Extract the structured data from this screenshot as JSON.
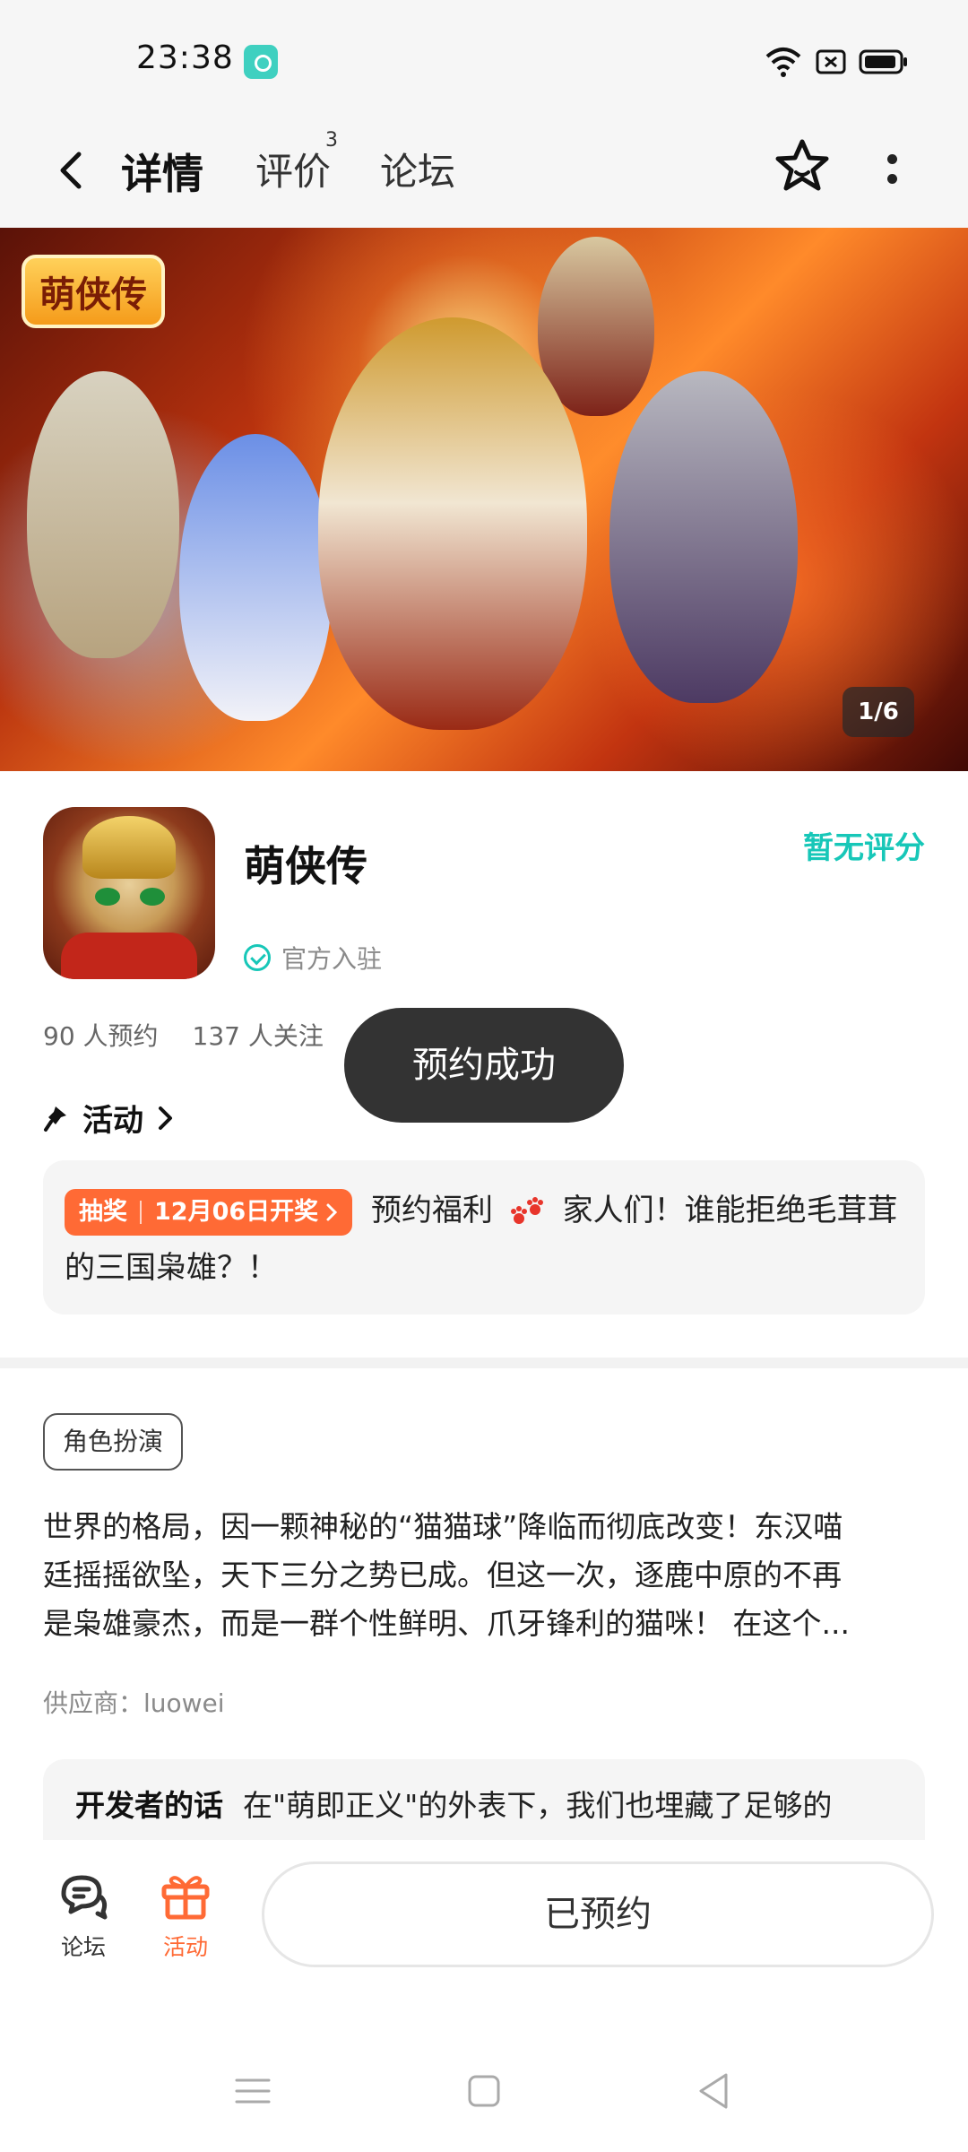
{
  "status_bar": {
    "time": "23:38"
  },
  "nav": {
    "tabs": [
      {
        "label": "详情"
      },
      {
        "label": "评价",
        "badge": "3"
      },
      {
        "label": "论坛"
      }
    ]
  },
  "banner": {
    "logo_text": "萌侠传",
    "pager": "1/6"
  },
  "game": {
    "name": "萌侠传",
    "official_label": "官方入驻",
    "rating_text": "暂无评分",
    "reservations": "90 人预约",
    "followers": "137 人关注"
  },
  "toast": {
    "text": "预约成功"
  },
  "activity": {
    "heading": "活动",
    "tag_type": "抽奖",
    "tag_date": "12月06日开奖",
    "text_before_emoji": "预约福利",
    "text_after_emoji": "家人们！谁能拒绝毛茸茸的三国枭雄？！"
  },
  "genre_tag": "角色扮演",
  "description": {
    "line1": "世界的格局，因一颗神秘的“猫猫球”降临而彻底改变！东汉喵",
    "line2": "廷摇摇欲坠，天下三分之势已成。但这一次，逐鹿中原的不再",
    "line3": "是枭雄豪杰，而是一群个性鲜明、爪牙锋利的猫咪！ 在这个..."
  },
  "supplier": "供应商：luowei",
  "developer": {
    "title": "开发者的话",
    "text": "在\"萌即正义\"的外表下，我们也埋藏了足够的"
  },
  "bottom_bar": {
    "forum_label": "论坛",
    "activity_label": "活动",
    "reserve_button": "已预约"
  },
  "colors": {
    "accent_teal": "#17c7b8",
    "accent_orange": "#ff6a35",
    "toast_bg": "#333333"
  }
}
